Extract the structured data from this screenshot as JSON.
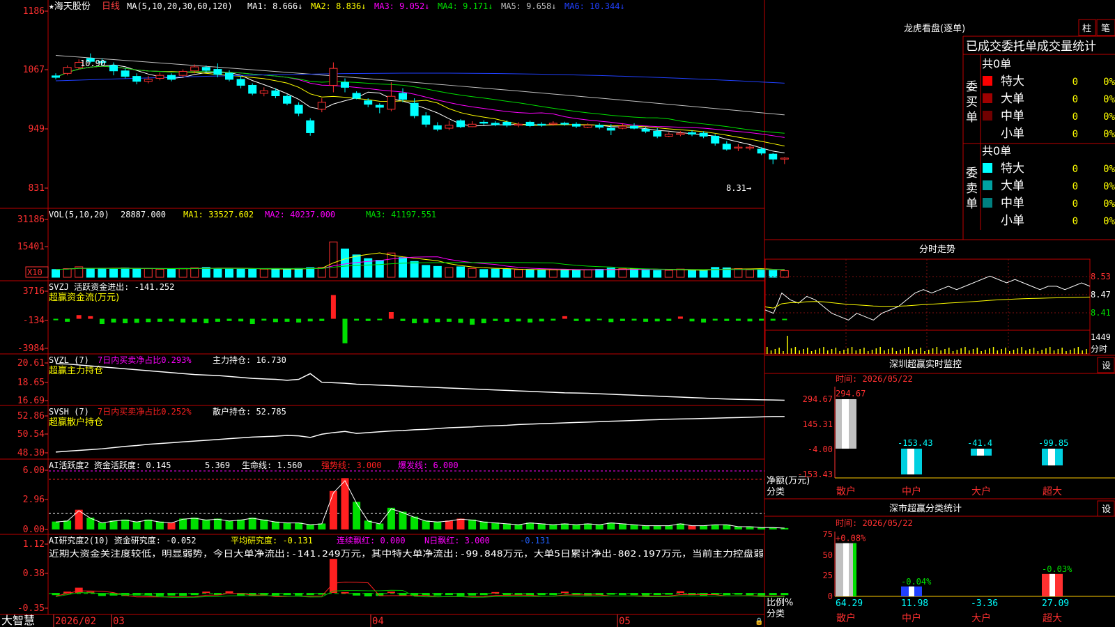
{
  "header": {
    "stock": "★海天股份",
    "period": "日线",
    "ma_label": "MA(5,10,20,30,60,120)",
    "ma_items": [
      {
        "text": "MA1: 8.666",
        "color": "#ffffff"
      },
      {
        "text": "MA2: 8.836",
        "color": "#ffff00"
      },
      {
        "text": "MA3: 9.052",
        "color": "#ff00ff"
      },
      {
        "text": "MA4: 9.171",
        "color": "#00e000"
      },
      {
        "text": "MA5: 9.658",
        "color": "#c0c0c0"
      },
      {
        "text": "MA6: 10.344",
        "color": "#2040ff"
      }
    ]
  },
  "price_axis": [
    "1186",
    "1067",
    "949",
    "831"
  ],
  "price_annotations": {
    "high": "10.90",
    "last": "8.31→"
  },
  "vol_panel": {
    "title": "VOL(5,10,20)",
    "value": "28887.000",
    "ma1": "MA1: 33527.602",
    "ma2": "MA2: 40237.000",
    "ma3": "MA3: 41197.551",
    "axis": [
      "31186",
      "15401"
    ],
    "unit": "X10"
  },
  "svzj_panel": {
    "title": "SVZJ  活跃资金进出: -141.252",
    "subtitle": "超赢资金流(万元)",
    "axis": [
      "3716",
      "-134",
      "-3984"
    ]
  },
  "svzl_panel": {
    "title": "SVZL (7)",
    "ratio": "7日内买卖净占比0.293%",
    "main": "主力持仓: 16.730",
    "subtitle": "超赢主力持仓",
    "axis": [
      "20.61",
      "18.65",
      "16.69"
    ]
  },
  "svsh_panel": {
    "title": "SVSH (7)",
    "ratio": "7日内买卖净占比0.252%",
    "main": "散户持仓: 52.785",
    "subtitle": "超赢散户持仓",
    "axis": [
      "52.86",
      "50.54",
      "48.30"
    ]
  },
  "ai_active_panel": {
    "title": "AI活跃度2 资金活跃度: 0.145",
    "v2": "5.369",
    "v3": "生命线: 1.560",
    "v4": "强势线: 3.000",
    "v5": "爆发线: 6.000",
    "axis": [
      "6.00",
      "2.96",
      "0.00"
    ]
  },
  "ai_research_panel": {
    "title": "AI研究度2(10) 资金研究度: -0.052",
    "avg": "平均研究度: -0.131",
    "red": "连续飘红: 0.000",
    "nred": "N日飘红: 3.000",
    "last": "-0.131",
    "comment": "近期大资金关注度较低，明显弱势，今日大单净流出:-141.249万元，其中特大单净流出:-99.848万元，大单5日累计净出-802.197万元，当前主力控盘弱",
    "axis": [
      "1.12",
      "0.38",
      "-0.35"
    ]
  },
  "x_axis": {
    "brand": "大智慧",
    "labels": [
      "2026/02",
      "03",
      "04",
      "05"
    ]
  },
  "dragon_panel": {
    "title": "龙虎看盘(逐单)",
    "btn1": "柱",
    "btn2": "笔",
    "tabs": "已成交委托单成交量统计",
    "buy_label": "委买单",
    "sell_label": "委卖单",
    "buy_total": "共0单",
    "sell_total": "共0单",
    "buy_rows": [
      {
        "name": "特大",
        "n": "0",
        "p": "0%",
        "color": "#ff0000"
      },
      {
        "name": "大单",
        "n": "0",
        "p": "0%",
        "color": "#a00000"
      },
      {
        "name": "中单",
        "n": "0",
        "p": "0%",
        "color": "#700000"
      },
      {
        "name": "小单",
        "n": "0",
        "p": "0%",
        "color": ""
      }
    ],
    "sell_rows": [
      {
        "name": "特大",
        "n": "0",
        "p": "0%",
        "color": "#00ffff"
      },
      {
        "name": "大单",
        "n": "0",
        "p": "0%",
        "color": "#00a0a0"
      },
      {
        "name": "中单",
        "n": "0",
        "p": "0%",
        "color": "#008080"
      },
      {
        "name": "小单",
        "n": "0",
        "p": "0%",
        "color": ""
      }
    ]
  },
  "intraday_panel": {
    "title": "分时走势",
    "axis": [
      "8.53",
      "8.47",
      "8.41"
    ],
    "vol_label": "1449",
    "unit": "分时"
  },
  "sz_monitor": {
    "title": "深圳超赢实时监控",
    "btn": "设",
    "time": "时间: 2026/05/22",
    "axis": [
      "294.67",
      "145.31",
      "-4.00",
      "-153.43"
    ],
    "ylabel1": "净额(万元)",
    "ylabel2": "分类"
  },
  "sz_class": {
    "title": "深市超赢分类统计",
    "btn": "设",
    "time": "时间: 2026/05/22",
    "axis": [
      "75",
      "50",
      "25",
      "0"
    ],
    "ylabel1": "比例%",
    "ylabel2": "分类"
  },
  "chart_data": [
    {
      "type": "candlestick",
      "title": "海天股份 日线",
      "ylim": [
        8.31,
        11.86
      ],
      "x_labels": [
        "2026/02",
        "03",
        "04",
        "05"
      ],
      "candles": [
        [
          10.45,
          10.42,
          10.5,
          10.38
        ],
        [
          10.5,
          10.62,
          10.66,
          10.46
        ],
        [
          10.62,
          10.72,
          10.78,
          10.58
        ],
        [
          10.8,
          10.74,
          10.9,
          10.7
        ],
        [
          10.74,
          10.72,
          10.8,
          10.66
        ],
        [
          10.66,
          10.55,
          10.72,
          10.46
        ],
        [
          10.55,
          10.44,
          10.6,
          10.4
        ],
        [
          10.44,
          10.34,
          10.5,
          10.28
        ],
        [
          10.34,
          10.38,
          10.45,
          10.3
        ],
        [
          10.4,
          10.46,
          10.52,
          10.36
        ],
        [
          10.46,
          10.38,
          10.5,
          10.34
        ],
        [
          10.46,
          10.54,
          10.58,
          10.42
        ],
        [
          10.55,
          10.63,
          10.68,
          10.5
        ],
        [
          10.62,
          10.56,
          10.66,
          10.52
        ],
        [
          10.58,
          10.48,
          10.7,
          10.42
        ],
        [
          10.5,
          10.38,
          10.56,
          10.34
        ],
        [
          10.38,
          10.26,
          10.45,
          10.2
        ],
        [
          10.26,
          10.1,
          10.3,
          10.06
        ],
        [
          10.1,
          10.15,
          10.22,
          10.04
        ],
        [
          10.15,
          10.05,
          10.2,
          10.0
        ],
        [
          10.04,
          9.9,
          10.08,
          9.86
        ],
        [
          9.86,
          9.7,
          9.92,
          9.64
        ],
        [
          9.55,
          9.31,
          9.6,
          9.25
        ],
        [
          9.78,
          9.92,
          10.0,
          9.72
        ],
        [
          10.26,
          10.6,
          10.72,
          10.12
        ],
        [
          10.32,
          10.22,
          10.4,
          10.12
        ],
        [
          10.1,
          10.0,
          10.14,
          9.98
        ],
        [
          9.95,
          9.88,
          10.0,
          9.82
        ],
        [
          9.86,
          9.82,
          9.9,
          9.7
        ],
        [
          9.78,
          10.04,
          10.32,
          9.74
        ],
        [
          10.1,
          9.98,
          10.2,
          9.92
        ],
        [
          9.9,
          9.65,
          10.0,
          9.6
        ],
        [
          9.65,
          9.48,
          9.72,
          9.42
        ],
        [
          9.45,
          9.38,
          9.52,
          9.34
        ],
        [
          9.4,
          9.46,
          9.55,
          9.36
        ],
        [
          9.55,
          9.43,
          9.58,
          9.4
        ],
        [
          9.43,
          9.48,
          9.54,
          9.42
        ],
        [
          9.52,
          9.5,
          9.56,
          9.46
        ],
        [
          9.5,
          9.47,
          9.54,
          9.44
        ],
        [
          9.52,
          9.46,
          9.56,
          9.42
        ],
        [
          9.46,
          9.48,
          9.52,
          9.42
        ],
        [
          9.52,
          9.45,
          9.55,
          9.42
        ],
        [
          9.48,
          9.46,
          9.52,
          9.43
        ],
        [
          9.48,
          9.5,
          9.54,
          9.45
        ],
        [
          9.5,
          9.48,
          9.53,
          9.45
        ],
        [
          9.48,
          9.44,
          9.52,
          9.4
        ],
        [
          9.42,
          9.46,
          9.5,
          9.4
        ],
        [
          9.46,
          9.42,
          9.5,
          9.38
        ],
        [
          9.4,
          9.36,
          9.48,
          9.26
        ],
        [
          9.4,
          9.44,
          9.5,
          9.38
        ],
        [
          9.44,
          9.4,
          9.5,
          9.38
        ],
        [
          9.38,
          9.34,
          9.42,
          9.3
        ],
        [
          9.34,
          9.24,
          9.4,
          9.2
        ],
        [
          9.24,
          9.28,
          9.32,
          9.22
        ],
        [
          9.27,
          9.3,
          9.34,
          9.24
        ],
        [
          9.31,
          9.28,
          9.36,
          9.24
        ],
        [
          9.3,
          9.24,
          9.34,
          9.2
        ],
        [
          9.24,
          9.1,
          9.28,
          9.05
        ],
        [
          9.08,
          8.98,
          9.14,
          8.95
        ],
        [
          9.0,
          9.02,
          9.08,
          8.94
        ],
        [
          9.0,
          9.02,
          9.06,
          8.96
        ],
        [
          8.98,
          8.9,
          9.02,
          8.86
        ],
        [
          8.88,
          8.78,
          8.9,
          8.68
        ],
        [
          8.78,
          8.8,
          8.82,
          8.68
        ]
      ]
    },
    {
      "type": "bar",
      "title": "VOL(5,10,20)",
      "ylim": [
        0,
        31186
      ],
      "values": [
        3800,
        4200,
        5100,
        4300,
        4400,
        4000,
        4500,
        4300,
        4200,
        3900,
        4100,
        4300,
        4600,
        4800,
        4400,
        4200,
        4100,
        3900,
        4000,
        4200,
        4000,
        4300,
        4700,
        4800,
        17200,
        13800,
        10900,
        9100,
        8300,
        11800,
        9600,
        7700,
        5800,
        5300,
        4700,
        5100,
        4300,
        3800,
        4000,
        3900,
        3700,
        3700,
        3400,
        3600,
        3800,
        3500,
        3600,
        3900,
        4500,
        4200,
        4100,
        3500,
        3300,
        3400,
        4000,
        3300,
        3200,
        4800,
        4600,
        4200,
        3600,
        3800,
        3300,
        3200
      ]
    },
    {
      "type": "bar",
      "title": "SVZJ 超赢资金流(万元)",
      "ylim": [
        -3984,
        3716
      ],
      "values": [
        -200,
        -400,
        500,
        350,
        -700,
        -500,
        -600,
        -550,
        -450,
        -400,
        -350,
        -500,
        -450,
        -600,
        -400,
        -300,
        -350,
        -700,
        -250,
        -450,
        -400,
        -500,
        -350,
        -300,
        3200,
        -3300,
        -250,
        -300,
        -200,
        900,
        -300,
        -600,
        -550,
        -450,
        -400,
        -550,
        -800,
        -600,
        -300,
        -400,
        -350,
        -500,
        -350,
        -250,
        350,
        -300,
        -350,
        -200,
        -450,
        -300,
        -250,
        -400,
        -350,
        -300,
        300,
        -350,
        -500,
        -250,
        -300,
        -280,
        -350,
        -260,
        -260,
        -141
      ]
    },
    {
      "type": "line",
      "title": "SVZL 超赢主力持仓",
      "ylim": [
        16.69,
        20.61
      ],
      "values": [
        20.55,
        20.5,
        20.4,
        20.3,
        20.2,
        20.1,
        20.0,
        19.9,
        19.8,
        19.7,
        19.6,
        19.5,
        19.4,
        19.35,
        19.3,
        19.2,
        19.1,
        19.0,
        18.95,
        18.9,
        18.8,
        18.9,
        19.5,
        18.6,
        18.55,
        18.5,
        18.4,
        18.35,
        18.3,
        18.25,
        18.2,
        18.15,
        18.1,
        18.05,
        18.0,
        17.95,
        17.9,
        17.85,
        17.8,
        17.75,
        17.7,
        17.65,
        17.6,
        17.55,
        17.5,
        17.48,
        17.45,
        17.4,
        17.35,
        17.3,
        17.25,
        17.2,
        17.15,
        17.1,
        17.05,
        17.0,
        16.95,
        16.9,
        16.85,
        16.82,
        16.8,
        16.77,
        16.75,
        16.73
      ]
    },
    {
      "type": "line",
      "title": "SVSH 超赢散户持仓",
      "ylim": [
        48.3,
        52.86
      ],
      "values": [
        48.4,
        48.5,
        48.6,
        48.7,
        48.8,
        48.95,
        49.1,
        49.2,
        49.35,
        49.45,
        49.55,
        49.65,
        49.75,
        49.85,
        49.95,
        50.05,
        50.15,
        50.25,
        50.3,
        50.35,
        50.45,
        50.4,
        50.2,
        50.6,
        50.8,
        50.95,
        50.7,
        50.8,
        50.9,
        51.0,
        51.05,
        51.15,
        51.2,
        51.3,
        51.4,
        51.45,
        51.5,
        51.6,
        51.65,
        51.7,
        51.8,
        51.85,
        51.9,
        51.95,
        52.0,
        52.05,
        52.1,
        52.15,
        52.2,
        52.25,
        52.3,
        52.35,
        52.4,
        52.45,
        52.48,
        52.5,
        52.55,
        52.58,
        52.62,
        52.66,
        52.7,
        52.74,
        52.78,
        52.79
      ]
    },
    {
      "type": "bar",
      "title": "AI活跃度2",
      "ylim": [
        0,
        6.0
      ],
      "values": [
        0.8,
        0.9,
        2.0,
        1.2,
        0.7,
        0.9,
        1.0,
        0.8,
        1.0,
        0.8,
        0.7,
        1.1,
        1.2,
        1.0,
        1.1,
        0.9,
        1.0,
        1.2,
        1.0,
        0.8,
        0.7,
        0.7,
        0.5,
        0.6,
        3.9,
        5.2,
        2.8,
        0.9,
        0.6,
        2.2,
        1.8,
        1.3,
        0.9,
        0.8,
        0.9,
        1.1,
        1.0,
        0.8,
        0.7,
        0.6,
        0.5,
        0.7,
        0.6,
        0.5,
        0.6,
        0.5,
        0.6,
        0.5,
        0.7,
        0.6,
        0.5,
        0.4,
        0.4,
        0.4,
        0.6,
        0.4,
        0.4,
        0.5,
        0.5,
        0.3,
        0.3,
        0.2,
        0.2,
        0.15
      ]
    },
    {
      "type": "bar",
      "title": "AI研究度2(10)",
      "ylim": [
        -0.35,
        1.12
      ],
      "values": [
        -0.05,
        0.03,
        0.12,
        0.03,
        -0.07,
        -0.06,
        -0.07,
        -0.06,
        -0.06,
        -0.07,
        -0.06,
        -0.07,
        -0.05,
        0.03,
        -0.05,
        0.04,
        -0.06,
        -0.07,
        -0.05,
        -0.06,
        -0.05,
        -0.06,
        -0.05,
        -0.04,
        0.78,
        0.02,
        -0.06,
        -0.08,
        -0.07,
        0.03,
        -0.06,
        -0.07,
        -0.06,
        -0.06,
        -0.05,
        -0.07,
        -0.06,
        -0.05,
        0.02,
        -0.06,
        -0.05,
        -0.06,
        -0.05,
        -0.05,
        0.03,
        -0.05,
        -0.06,
        -0.05,
        -0.04,
        -0.05,
        -0.05,
        -0.06,
        -0.05,
        -0.04,
        0.04,
        -0.05,
        -0.06,
        -0.04,
        -0.05,
        -0.04,
        -0.05,
        -0.06,
        -0.05,
        -0.05
      ]
    },
    {
      "type": "line",
      "title": "分时走势",
      "ylim": [
        8.35,
        8.56
      ],
      "values": [
        8.41,
        8.4,
        8.46,
        8.44,
        8.43,
        8.45,
        8.44,
        8.42,
        8.4,
        8.39,
        8.38,
        8.4,
        8.39,
        8.38,
        8.4,
        8.41,
        8.42,
        8.44,
        8.46,
        8.47,
        8.46,
        8.47,
        8.48,
        8.47,
        8.48,
        8.49,
        8.5,
        8.51,
        8.5,
        8.49,
        8.5,
        8.49,
        8.48,
        8.47,
        8.48,
        8.48,
        8.47,
        8.48,
        8.49,
        8.48
      ]
    },
    {
      "type": "bar",
      "title": "深圳超赢实时监控",
      "categories": [
        "散户",
        "中户",
        "大户",
        "超大"
      ],
      "values": [
        294.67,
        -153.43,
        -41.4,
        -99.85
      ],
      "ylim": [
        -153.43,
        294.67
      ]
    },
    {
      "type": "bar",
      "title": "深市超赢分类统计",
      "categories": [
        "散户",
        "中户",
        "大户",
        "超大"
      ],
      "values": [
        64.29,
        11.98,
        -3.36,
        27.09
      ],
      "changes": [
        "+0.08%",
        "-0.04%",
        "",
        "-0.03%"
      ],
      "ylim": [
        0,
        75
      ]
    }
  ]
}
